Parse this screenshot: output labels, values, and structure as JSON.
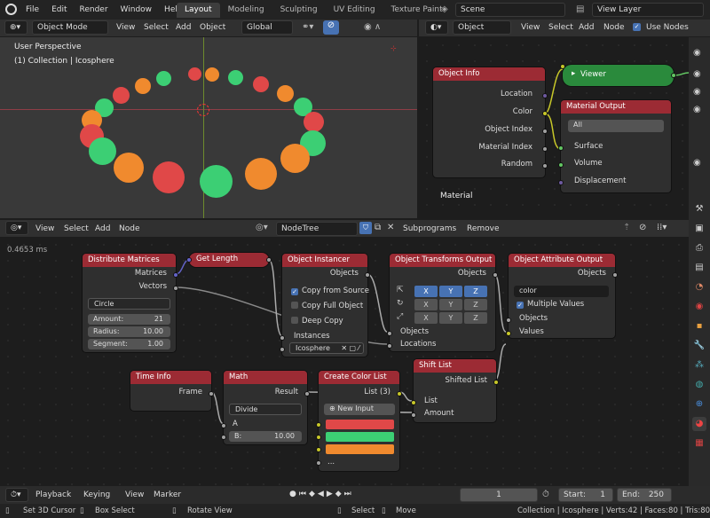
{
  "menu": {
    "items": [
      "File",
      "Edit",
      "Render",
      "Window",
      "Help"
    ]
  },
  "workspaces": [
    "Layout",
    "Modeling",
    "Sculpting",
    "UV Editing",
    "Texture Paint",
    "Sh"
  ],
  "scene": "Scene",
  "view_layer": "View Layer",
  "viewport": {
    "mode": "Object Mode",
    "menus": [
      "View",
      "Select",
      "Add",
      "Object"
    ],
    "transform": "Global",
    "title": "User Perspective",
    "collection": "(1) Collection | Icosphere"
  },
  "shader_editor": {
    "type": "Object",
    "menus": [
      "View",
      "Select",
      "Add",
      "Node"
    ],
    "use_nodes": "Use Nodes",
    "material": "Material",
    "object_info": {
      "title": "Object Info",
      "outputs": [
        "Location",
        "Color",
        "Object Index",
        "Material Index",
        "Random"
      ]
    },
    "viewer": {
      "title": "Viewer"
    },
    "material_output": {
      "title": "Material Output",
      "target": "All",
      "inputs": [
        "Surface",
        "Volume",
        "Displacement"
      ]
    }
  },
  "node_editor": {
    "menus": [
      "View",
      "Select",
      "Add",
      "Node"
    ],
    "tree": "NodeTree",
    "subprograms": "Subprograms",
    "remove": "Remove",
    "timing": "0.4653 ms",
    "distribute": {
      "title": "Distribute Matrices",
      "outputs": [
        "Matrices",
        "Vectors"
      ],
      "mode": "Circle",
      "amount_label": "Amount:",
      "amount": "21",
      "radius_label": "Radius:",
      "radius": "10.00",
      "segment_label": "Segment:",
      "segment": "1.00"
    },
    "get_length": {
      "title": "Get Length"
    },
    "instancer": {
      "title": "Object Instancer",
      "out": "Objects",
      "copy_source": "Copy from Source",
      "copy_full": "Copy Full Object",
      "deep_copy": "Deep Copy",
      "instances": "Instances",
      "object": "Icosphere"
    },
    "transforms": {
      "title": "Object Transforms Output",
      "out": "Objects",
      "axes": [
        "X",
        "Y",
        "Z"
      ],
      "in_objects": "Objects",
      "in_locations": "Locations"
    },
    "attribute": {
      "title": "Object Attribute Output",
      "out": "Objects",
      "attr": "color",
      "multiple": "Multiple Values",
      "in_objects": "Objects",
      "in_values": "Values"
    },
    "time_info": {
      "title": "Time Info",
      "out": "Frame"
    },
    "math": {
      "title": "Math",
      "out": "Result",
      "op": "Divide",
      "a": "A",
      "b_label": "B:",
      "b": "10.00"
    },
    "color_list": {
      "title": "Create Color List",
      "out": "List (3)",
      "new_input": "New Input",
      "more": "...",
      "colors": [
        "#e04848",
        "#3ccf74",
        "#f08a2e"
      ]
    },
    "shift_list": {
      "title": "Shift List",
      "out": "Shifted List",
      "in_list": "List",
      "in_amount": "Amount"
    }
  },
  "timeline": {
    "menus": [
      "Playback",
      "Keying",
      "View",
      "Marker"
    ],
    "frame": "1",
    "start_label": "Start:",
    "start": "1",
    "end_label": "End:",
    "end": "250"
  },
  "status": {
    "left": [
      "Set 3D Cursor",
      "Box Select",
      "Rotate View"
    ],
    "mid": [
      "Select",
      "Move"
    ],
    "right": "Collection | Icosphere | Verts:42 | Faces:80 | Tris:80 | Ol"
  }
}
